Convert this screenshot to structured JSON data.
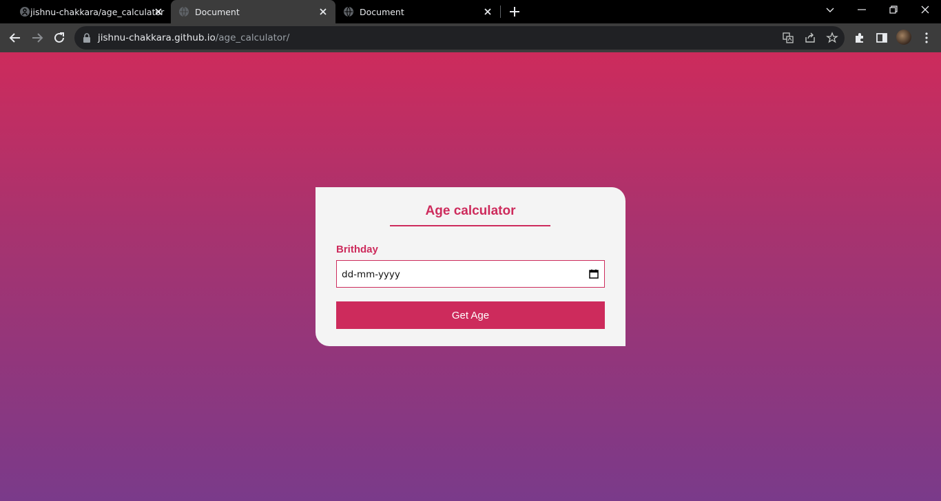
{
  "browser": {
    "tabs": [
      {
        "title": "jishnu-chakkara/age_calculator",
        "favicon": "github-icon",
        "active": false
      },
      {
        "title": "Document",
        "favicon": "globe-icon",
        "active": true
      },
      {
        "title": "Document",
        "favicon": "globe-icon",
        "active": false
      }
    ],
    "address_bar": {
      "host": "jishnu-chakkara.github.io",
      "path": "/age_calculator/"
    }
  },
  "page": {
    "title": "Age calculator",
    "birthday_label": "Brithday",
    "date_placeholder": "dd-mm-yyyy",
    "submit_label": "Get Age"
  },
  "colors": {
    "accent": "#cd2b5c",
    "gradient_top": "#cd2b5c",
    "gradient_bottom": "#7a3a8a",
    "card_background": "#f4f4f4"
  }
}
